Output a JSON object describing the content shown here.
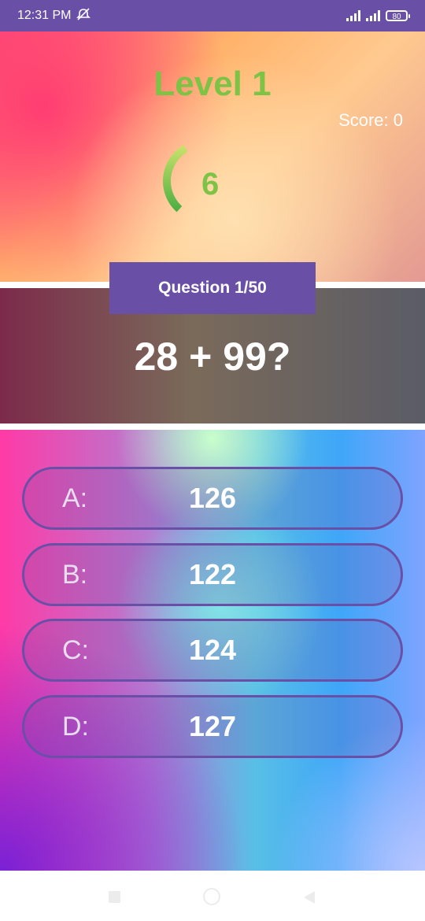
{
  "status_bar": {
    "time": "12:31 PM",
    "battery": "80",
    "icons": [
      "hotspot-muted-icon",
      "signal-icon",
      "signal-icon",
      "battery-icon"
    ]
  },
  "game": {
    "level_title": "Level 1",
    "score_text": "Score: 0",
    "timer_value": "6",
    "timer_progress": 0.3,
    "question_counter": "Question 1/50",
    "question": "28 + 99?"
  },
  "answers": [
    {
      "letter": "A:",
      "value": "126"
    },
    {
      "letter": "B:",
      "value": "122"
    },
    {
      "letter": "C:",
      "value": "124"
    },
    {
      "letter": "D:",
      "value": "127"
    }
  ],
  "colors": {
    "accent": "#6a4fa6",
    "level_green": "#7cc346"
  },
  "nav_bar": {
    "icons": [
      "recent-apps-icon",
      "home-icon",
      "back-icon"
    ]
  }
}
